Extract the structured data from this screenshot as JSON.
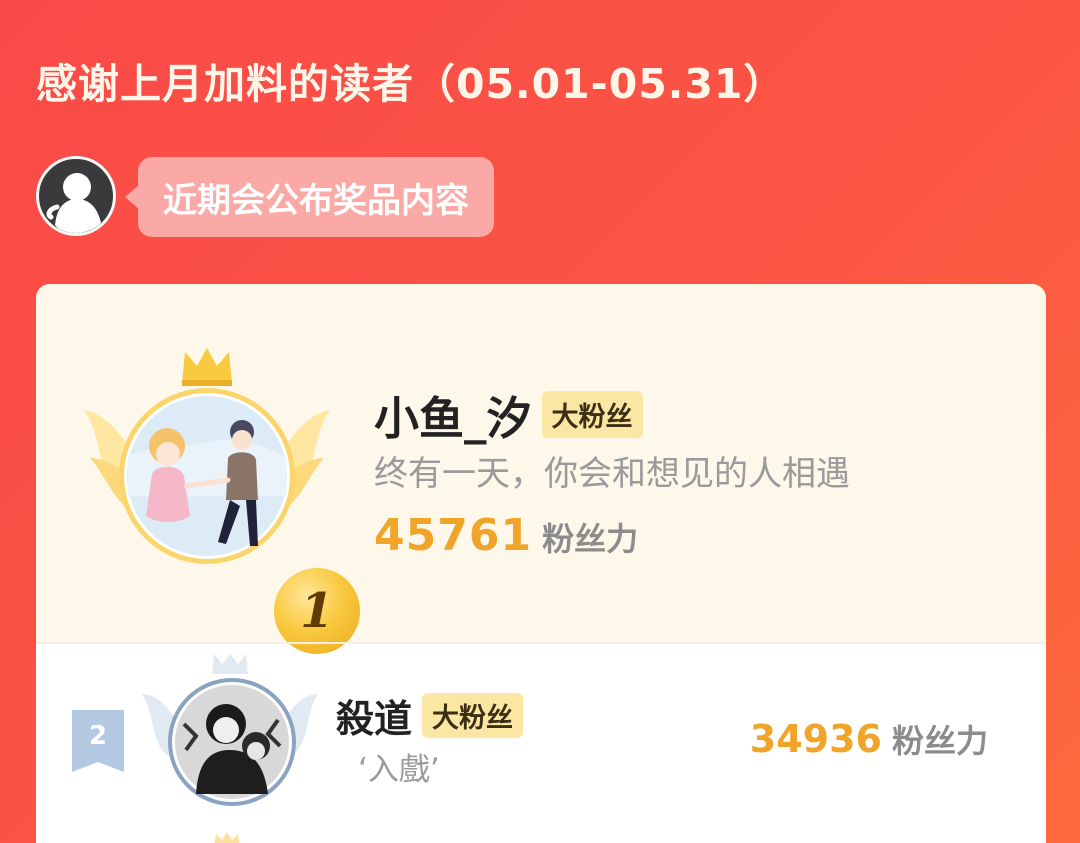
{
  "header": {
    "title": "感谢上月加料的读者（05.01-05.31）"
  },
  "notice": {
    "text": "近期会公布奖品内容"
  },
  "leaderboard": {
    "entries": [
      {
        "rank": "1",
        "name": "小鱼_汐",
        "badge": "大粉丝",
        "motto": "终有一天，你会和想见的人相遇",
        "power": "45761",
        "power_unit": "粉丝力"
      },
      {
        "rank": "2",
        "name": "殺道",
        "badge": "大粉丝",
        "motto": "‘入戲’",
        "power": "34936",
        "power_unit": "粉丝力"
      }
    ]
  },
  "colors": {
    "background": "#f94a47",
    "card_top": "#fdf8ea",
    "power_number": "#f0a52a",
    "badge": "#fbe7a4",
    "rank2_tag": "#b3c8e1"
  },
  "icons": {
    "crown": "crown-icon",
    "wings": "wings-icon",
    "notice_avatar": "ghost-avatar-icon"
  }
}
